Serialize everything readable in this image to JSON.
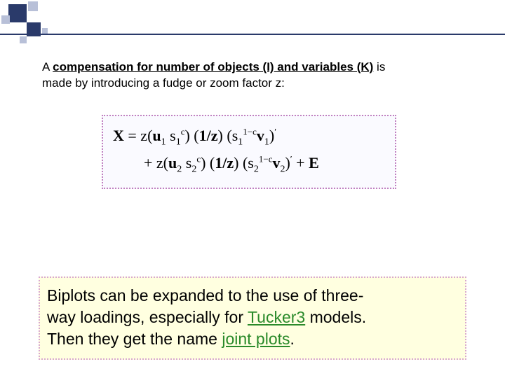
{
  "intro": {
    "prefix": "A ",
    "emph": "compensation for number of objects (I) and variables (K)",
    "suffix1": " is",
    "line2": " made by introducing a fudge or zoom factor z:"
  },
  "equation": {
    "line1_parts": {
      "X": "X",
      "eq": " = z(",
      "u1": "u",
      "sub1": "1",
      "sp": " ",
      "s1": "s",
      "s1sub": "1",
      "s1sup": "c",
      "rp": ") (",
      "oneoverz": "1/z",
      "rp2": ") (",
      "s1b": "s",
      "s1bsub": "1",
      "s1bsup": "1−c",
      "v1": "v",
      "v1sub": "1",
      "rp3": ")",
      "prime": "′"
    },
    "line2_parts": {
      "plus": "+ z(",
      "u2": "u",
      "u2sub": "2",
      "sp": " ",
      "s2": "s",
      "s2sub": "2",
      "s2sup": "c",
      "rp": ") (",
      "oneoverz": "1/z",
      "rp2": ") (",
      "s2b": "s",
      "s2bsub": "2",
      "s2bsup": "1−c",
      "v2": "v",
      "v2sub": "2",
      "rp3": ")",
      "prime": "′",
      "plusE": " + ",
      "E": "E"
    }
  },
  "note": {
    "t1": "Biplots can be expanded to the use of three-",
    "t2": "way loadings, especially for ",
    "tucker": "Tucker3",
    "t3": " models.",
    "t4": "Then they get the name ",
    "joint": "joint plots",
    "t5": "."
  }
}
